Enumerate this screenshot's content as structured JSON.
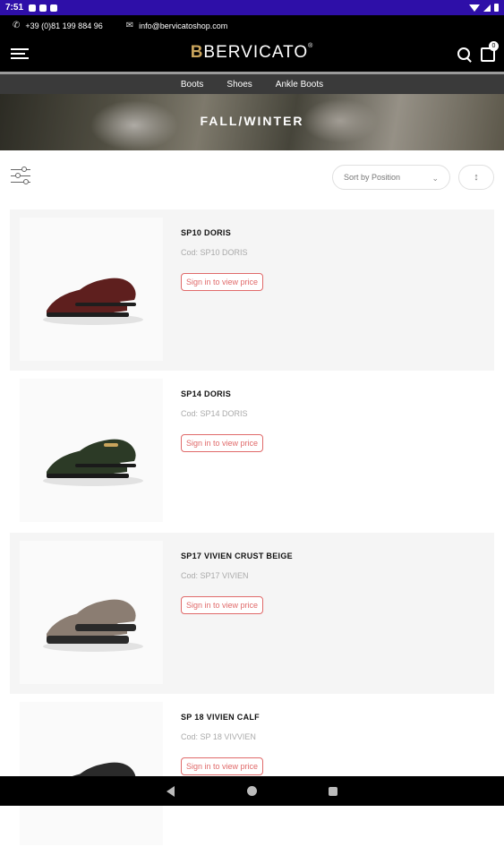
{
  "status": {
    "time": "7:51"
  },
  "contact": {
    "phone": "+39 (0)81 199 884 96",
    "email": "info@bervicatoshop.com"
  },
  "header": {
    "logo_mark": "B",
    "logo_text": "BERVICATO",
    "logo_reg": "®",
    "cart_count": "0"
  },
  "nav": {
    "items": [
      "Boots",
      "Shoes",
      "Ankle Boots"
    ]
  },
  "banner": {
    "title": "FALL/WINTER"
  },
  "toolbar": {
    "sort_label": "Sort by Position",
    "sort_chevron": "⌄",
    "direction_glyph": "↕"
  },
  "products": [
    {
      "name": "SP10 DORIS",
      "code": "Cod: SP10 DORIS",
      "price_label": "Sign in to view price",
      "shoe_color": "#5e1f1e",
      "sole_color": "#1e1e1e"
    },
    {
      "name": "SP14 DORIS",
      "code": "Cod: SP14 DORIS",
      "price_label": "Sign in to view price",
      "shoe_color": "#2c3a26",
      "sole_color": "#1a1a1a"
    },
    {
      "name": "SP17 VIVIEN CRUST BEIGE",
      "code": "Cod: SP17 VIVIEN",
      "price_label": "Sign in to view price",
      "shoe_color": "#8b7d72",
      "sole_color": "#2a2a2a"
    },
    {
      "name": "SP 18 VIVIEN CALF",
      "code": "Cod: SP 18 VIVVIEN",
      "price_label": "Sign in to view price",
      "shoe_color": "#2a2a2a",
      "sole_color": "#111111"
    }
  ],
  "colors": {
    "accent": "#e06a6a",
    "topbar": "#2e0fa8",
    "logo_gold": "#c9a45c"
  }
}
